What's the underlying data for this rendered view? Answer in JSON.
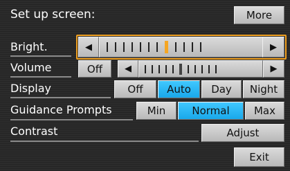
{
  "header": {
    "title": "Set up screen:",
    "more_label": "More"
  },
  "rows": {
    "bright": {
      "label": "Bright."
    },
    "volume": {
      "label": "Volume",
      "off_label": "Off"
    },
    "display": {
      "label": "Display",
      "options": [
        "Off",
        "Auto",
        "Day",
        "Night"
      ],
      "selected": "Auto"
    },
    "guidance": {
      "label": "Guidance Prompts",
      "options": [
        "Min",
        "Normal",
        "Max"
      ],
      "selected": "Normal"
    },
    "contrast": {
      "label": "Contrast",
      "button_label": "Adjust"
    }
  },
  "footer": {
    "exit_label": "Exit"
  },
  "glyphs": {
    "left": "◀",
    "right": "▶"
  },
  "colors": {
    "selected": "#29b6f6",
    "focus": "#f0a020"
  }
}
